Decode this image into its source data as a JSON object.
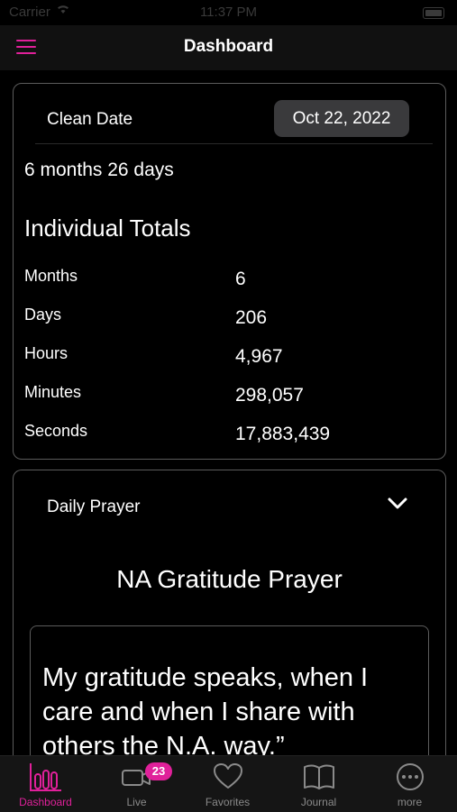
{
  "status_bar": {
    "carrier": "Carrier",
    "time": "11:37 PM"
  },
  "header": {
    "title": "Dashboard"
  },
  "clean_date": {
    "label": "Clean Date",
    "date": "Oct 22, 2022",
    "duration": "6 months 26 days"
  },
  "individual_totals": {
    "heading": "Individual Totals",
    "rows": [
      {
        "label": "Months",
        "value": "6"
      },
      {
        "label": "Days",
        "value": "206"
      },
      {
        "label": "Hours",
        "value": "4,967"
      },
      {
        "label": "Minutes",
        "value": "298,057"
      },
      {
        "label": "Seconds",
        "value": "17,883,439"
      }
    ]
  },
  "daily_prayer": {
    "label": "Daily Prayer",
    "title": "NA Gratitude Prayer",
    "text": "My gratitude speaks, when I care and when I share with others the N.A. way.”"
  },
  "tab_bar": {
    "tabs": [
      {
        "label": "Dashboard",
        "icon": "bar-chart-icon",
        "active": true
      },
      {
        "label": "Live",
        "icon": "video-camera-icon",
        "badge": "23"
      },
      {
        "label": "Favorites",
        "icon": "heart-icon"
      },
      {
        "label": "Journal",
        "icon": "book-icon"
      },
      {
        "label": "more",
        "icon": "more-icon"
      }
    ]
  },
  "colors": {
    "accent": "#e0209a",
    "background": "#000000",
    "card_border": "#5c5c5c",
    "pill": "#3a3a3c"
  }
}
